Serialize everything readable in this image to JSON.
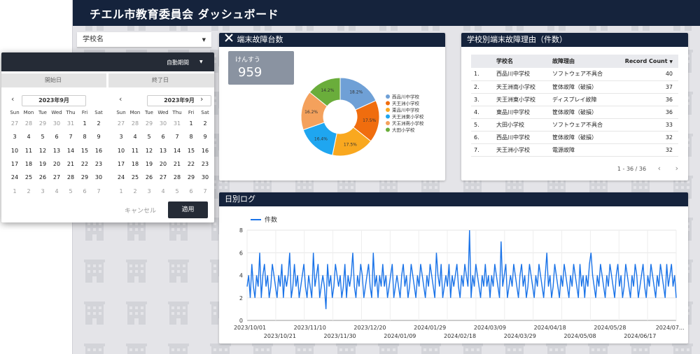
{
  "header": {
    "title": "チエル市教育委員会 ダッシュボード"
  },
  "filter": {
    "label": "学校名"
  },
  "date_picker": {
    "preset": "自動期間",
    "start_label": "開始日",
    "end_label": "終了日",
    "left_month": "2023年9月",
    "right_month": "2023年9月",
    "weekdays": [
      "Sun",
      "Mon",
      "Tue",
      "Wed",
      "Thu",
      "Fri",
      "Sat"
    ],
    "weeks": [
      [
        "27",
        "28",
        "29",
        "30",
        "31",
        "1",
        "2"
      ],
      [
        "3",
        "4",
        "5",
        "6",
        "7",
        "8",
        "9"
      ],
      [
        "10",
        "11",
        "12",
        "13",
        "14",
        "15",
        "16"
      ],
      [
        "17",
        "18",
        "19",
        "20",
        "21",
        "22",
        "23"
      ],
      [
        "24",
        "25",
        "26",
        "27",
        "28",
        "29",
        "30"
      ],
      [
        "1",
        "2",
        "3",
        "4",
        "5",
        "6",
        "7"
      ]
    ],
    "cancel_label": "キャンセル",
    "apply_label": "適用"
  },
  "failure_count_panel": {
    "title": "端末故障台数",
    "scorecard_label": "けんすう",
    "scorecard_value": "959"
  },
  "reason_panel": {
    "title": "学校別端末故障理由（件数）",
    "columns": [
      "学校名",
      "故障理由",
      "Record Count"
    ],
    "rows": [
      {
        "idx": "1.",
        "school": "西品川中学校",
        "reason": "ソフトウェア不具合",
        "count": "40"
      },
      {
        "idx": "2.",
        "school": "天王洲南小学校",
        "reason": "筐体故障（破損）",
        "count": "37"
      },
      {
        "idx": "3.",
        "school": "天王洲東小学校",
        "reason": "ディスプレイ故障",
        "count": "36"
      },
      {
        "idx": "4.",
        "school": "東品川中学校",
        "reason": "筐体故障（破損）",
        "count": "36"
      },
      {
        "idx": "5.",
        "school": "大田小学校",
        "reason": "ソフトウェア不具合",
        "count": "33"
      },
      {
        "idx": "6.",
        "school": "西品川中学校",
        "reason": "筐体故障（破損）",
        "count": "32"
      },
      {
        "idx": "7.",
        "school": "天王洲小学校",
        "reason": "電源故障",
        "count": "32"
      }
    ],
    "pagination": "1 - 36 / 36"
  },
  "daily_panel": {
    "title": "日別ログ"
  },
  "colors": {
    "header": "#15233c",
    "line": "#1a73e8"
  },
  "chart_data": [
    {
      "type": "pie",
      "title": "",
      "categories": [
        "西品川中学校",
        "天王洲小学校",
        "東品川中学校",
        "天王洲東小学校",
        "天王洲南小学校",
        "大田小学校"
      ],
      "values": [
        18.2,
        17.5,
        17.5,
        16.4,
        16.2,
        14.2
      ],
      "value_labels": [
        "18.2%",
        "17.5%",
        "17.5%",
        "16.4%",
        "16.2%",
        "14.2%"
      ],
      "colors": [
        "#6fa0d6",
        "#f06d0e",
        "#f9a81f",
        "#1fa6f0",
        "#f4a15c",
        "#6aad3b"
      ],
      "donut": true,
      "legend": "right"
    },
    {
      "type": "line",
      "title": "",
      "series": [
        {
          "name": "件数",
          "values": [
            3,
            4,
            2,
            5,
            3,
            2,
            4,
            3,
            6,
            2,
            4,
            5,
            3,
            4,
            2,
            3,
            5,
            4,
            3,
            2,
            4,
            3,
            5,
            2,
            4,
            3,
            4,
            6,
            2,
            3,
            5,
            3,
            4,
            2,
            3,
            4,
            5,
            3,
            2,
            4,
            3,
            2,
            6,
            3,
            4,
            5,
            2,
            3,
            4,
            3,
            1,
            5,
            3,
            4,
            2,
            3,
            5,
            4,
            3,
            4,
            2,
            3,
            5,
            2,
            4,
            3,
            4,
            6,
            3,
            2,
            4,
            3,
            5,
            4,
            2,
            3,
            4,
            5,
            3,
            2,
            6,
            3,
            4,
            2,
            4,
            3,
            5,
            3,
            4,
            2,
            3,
            4,
            5,
            2,
            3,
            4,
            3,
            2,
            4,
            5,
            3,
            4,
            2,
            3,
            5,
            4,
            3,
            2,
            4,
            3,
            5,
            4,
            3,
            2,
            4,
            3,
            5,
            4,
            3,
            2,
            6,
            4,
            3,
            5,
            2,
            3,
            4,
            3,
            5,
            2,
            4,
            3,
            4,
            5,
            3,
            2,
            4,
            3,
            5,
            4,
            3,
            8,
            2,
            4,
            3,
            5,
            4,
            3,
            2,
            4,
            3,
            5,
            3,
            4,
            2,
            4,
            3,
            5,
            4,
            3,
            2,
            7,
            3,
            4,
            5,
            2,
            3,
            4,
            3,
            5,
            4,
            3,
            2,
            4,
            5,
            3,
            4,
            2,
            3,
            5,
            4,
            3,
            2,
            4,
            3,
            5,
            4,
            3,
            2,
            4,
            6,
            3,
            4,
            2,
            3,
            5,
            4,
            3,
            2,
            4,
            3,
            5,
            4,
            3,
            2,
            4,
            3,
            5,
            4,
            3,
            2,
            5,
            3,
            4,
            2,
            4,
            3,
            5,
            6,
            4,
            3,
            2,
            4,
            3,
            5,
            4,
            3,
            2,
            4,
            3,
            5,
            4,
            3,
            2,
            4,
            5,
            3,
            4,
            2,
            3,
            5,
            4,
            3,
            2,
            4,
            3,
            5,
            4,
            2,
            3,
            4,
            5,
            3,
            2,
            4,
            3,
            5,
            4,
            3,
            2,
            4,
            3,
            5,
            4,
            3,
            2,
            5,
            3,
            4,
            5,
            3,
            4,
            2
          ]
        }
      ],
      "x_tick_labels_top": [
        "2023/10/01",
        "2023/11/10",
        "2023/12/20",
        "2024/01/29",
        "2024/03/09",
        "2024/04/18",
        "2024/05/28",
        "2024/07..."
      ],
      "x_tick_labels_bottom": [
        "2023/10/21",
        "2023/11/30",
        "2024/01/09",
        "2024/02/18",
        "2024/03/29",
        "2024/05/08",
        "2024/06/17"
      ],
      "y_ticks": [
        "0",
        "2",
        "4",
        "6",
        "8"
      ],
      "ylim": [
        0,
        8
      ],
      "grid": true,
      "legend": "top-left"
    }
  ]
}
